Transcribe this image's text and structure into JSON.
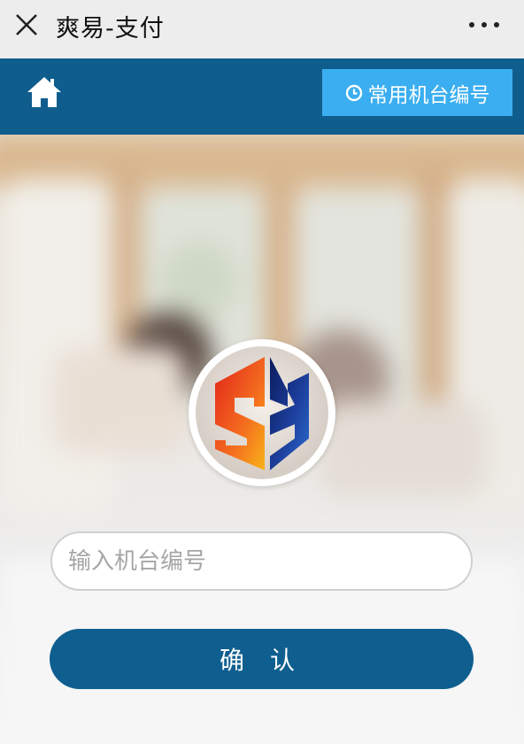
{
  "window": {
    "title": "爽易-支付",
    "close_icon": "close-icon",
    "more_icon": "more-dots-icon"
  },
  "nav": {
    "home_icon": "home-icon",
    "common_button_label": "常用机台编号",
    "common_button_icon": "clock-icon"
  },
  "form": {
    "machine_input_placeholder": "输入机台编号",
    "machine_input_value": "",
    "confirm_label": "确 认"
  },
  "colors": {
    "nav_bg": "#0f5d8d",
    "accent_button": "#3aaef0",
    "confirm_button": "#0e5f8f"
  }
}
